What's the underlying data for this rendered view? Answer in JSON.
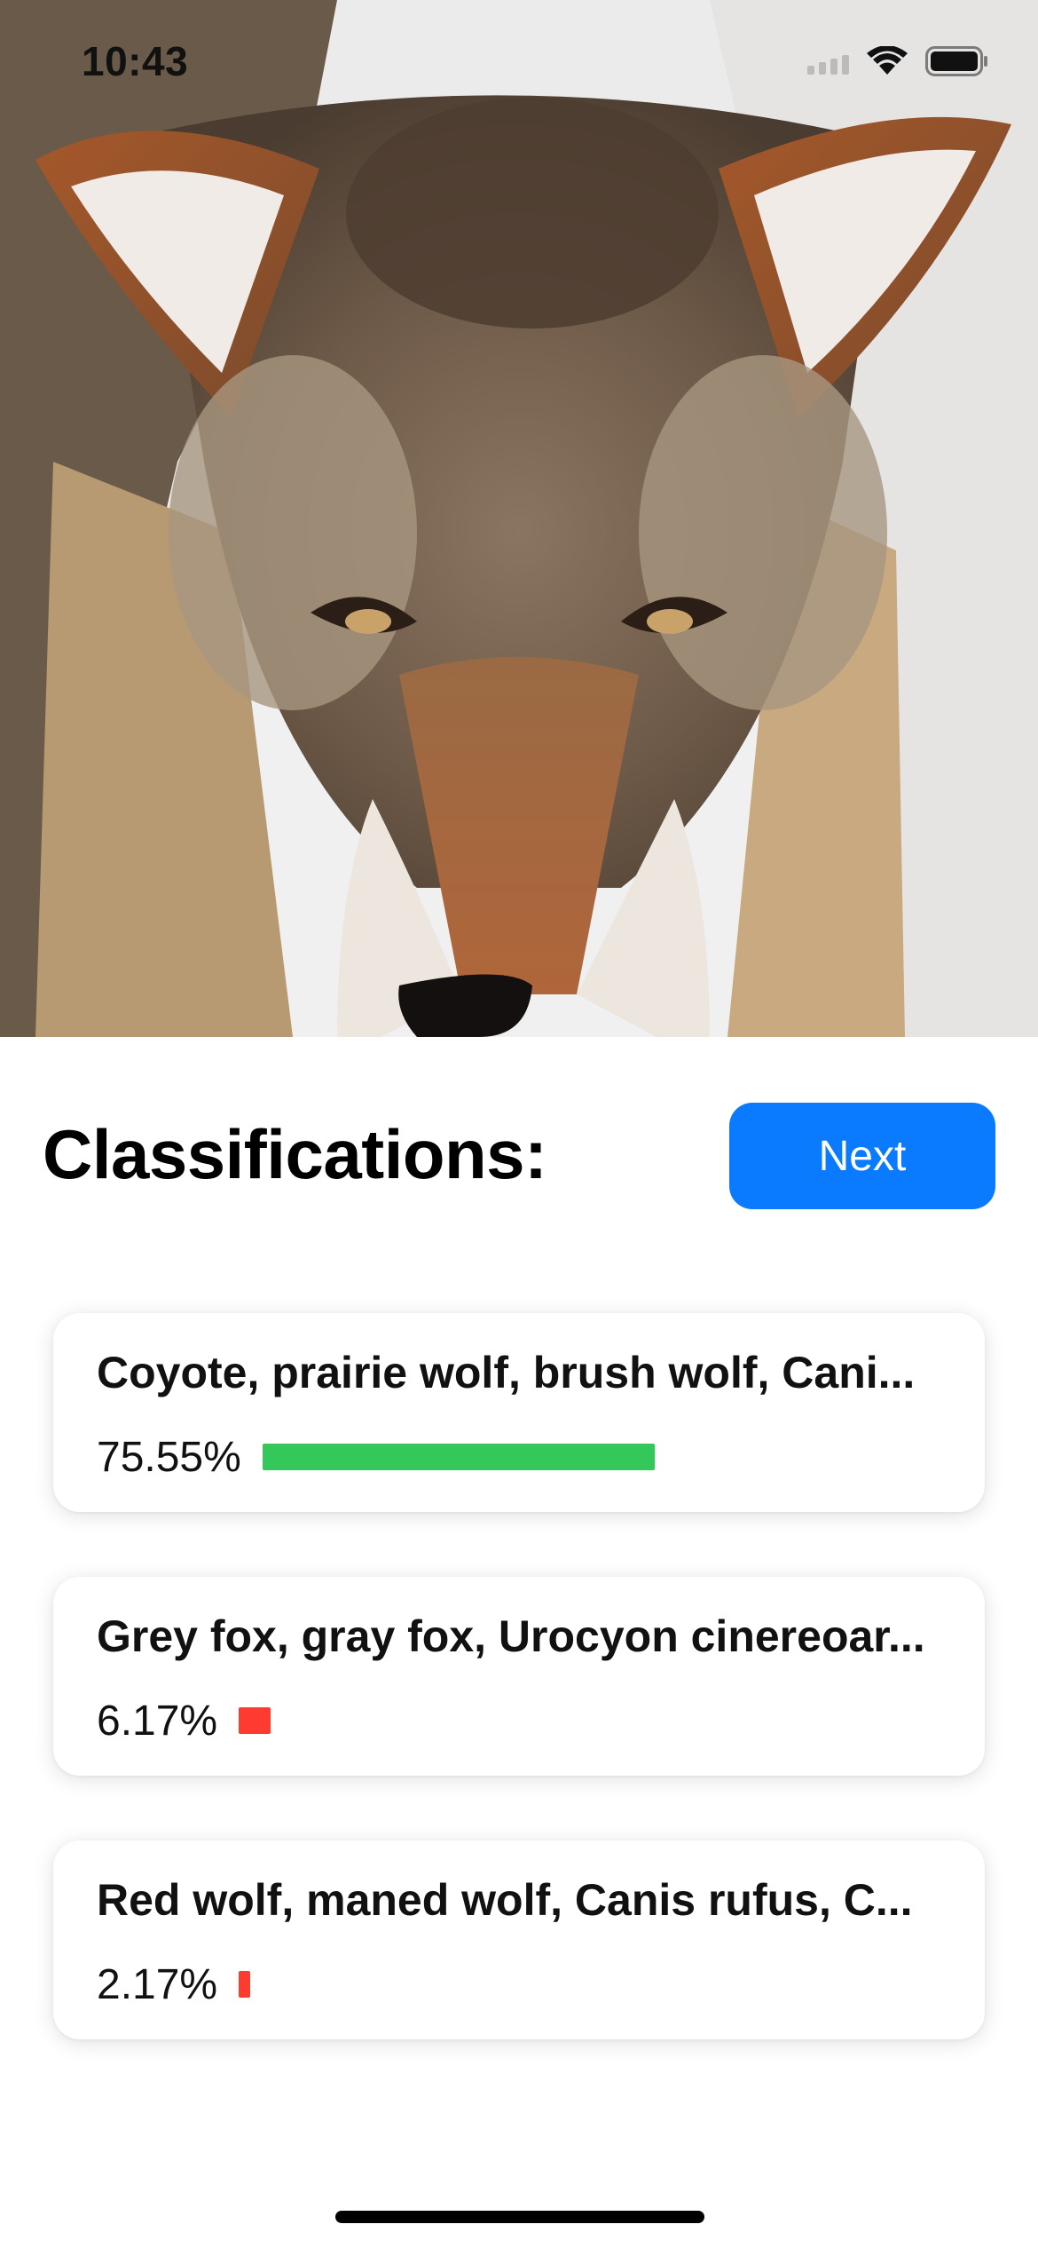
{
  "status_bar": {
    "time": "10:43",
    "icons": [
      "cellular-signal-icon",
      "wifi-icon",
      "battery-icon"
    ]
  },
  "photo": {
    "subject": "coyote-photo"
  },
  "header": {
    "title": "Classifications:",
    "next_label": "Next",
    "accent": "#0a7aff"
  },
  "classifications": [
    {
      "label": "Coyote, prairie wolf, brush wolf, Cani...",
      "percent_text": "75.55%",
      "fraction": 0.7555,
      "bar_color": "#34c759"
    },
    {
      "label": "Grey fox, gray fox, Urocyon cinereoar...",
      "percent_text": "6.17%",
      "fraction": 0.0617,
      "bar_color": "#ff3b30"
    },
    {
      "label": "Red wolf, maned wolf, Canis rufus, C...",
      "percent_text": "2.17%",
      "fraction": 0.0217,
      "bar_color": "#ff3b30"
    }
  ]
}
